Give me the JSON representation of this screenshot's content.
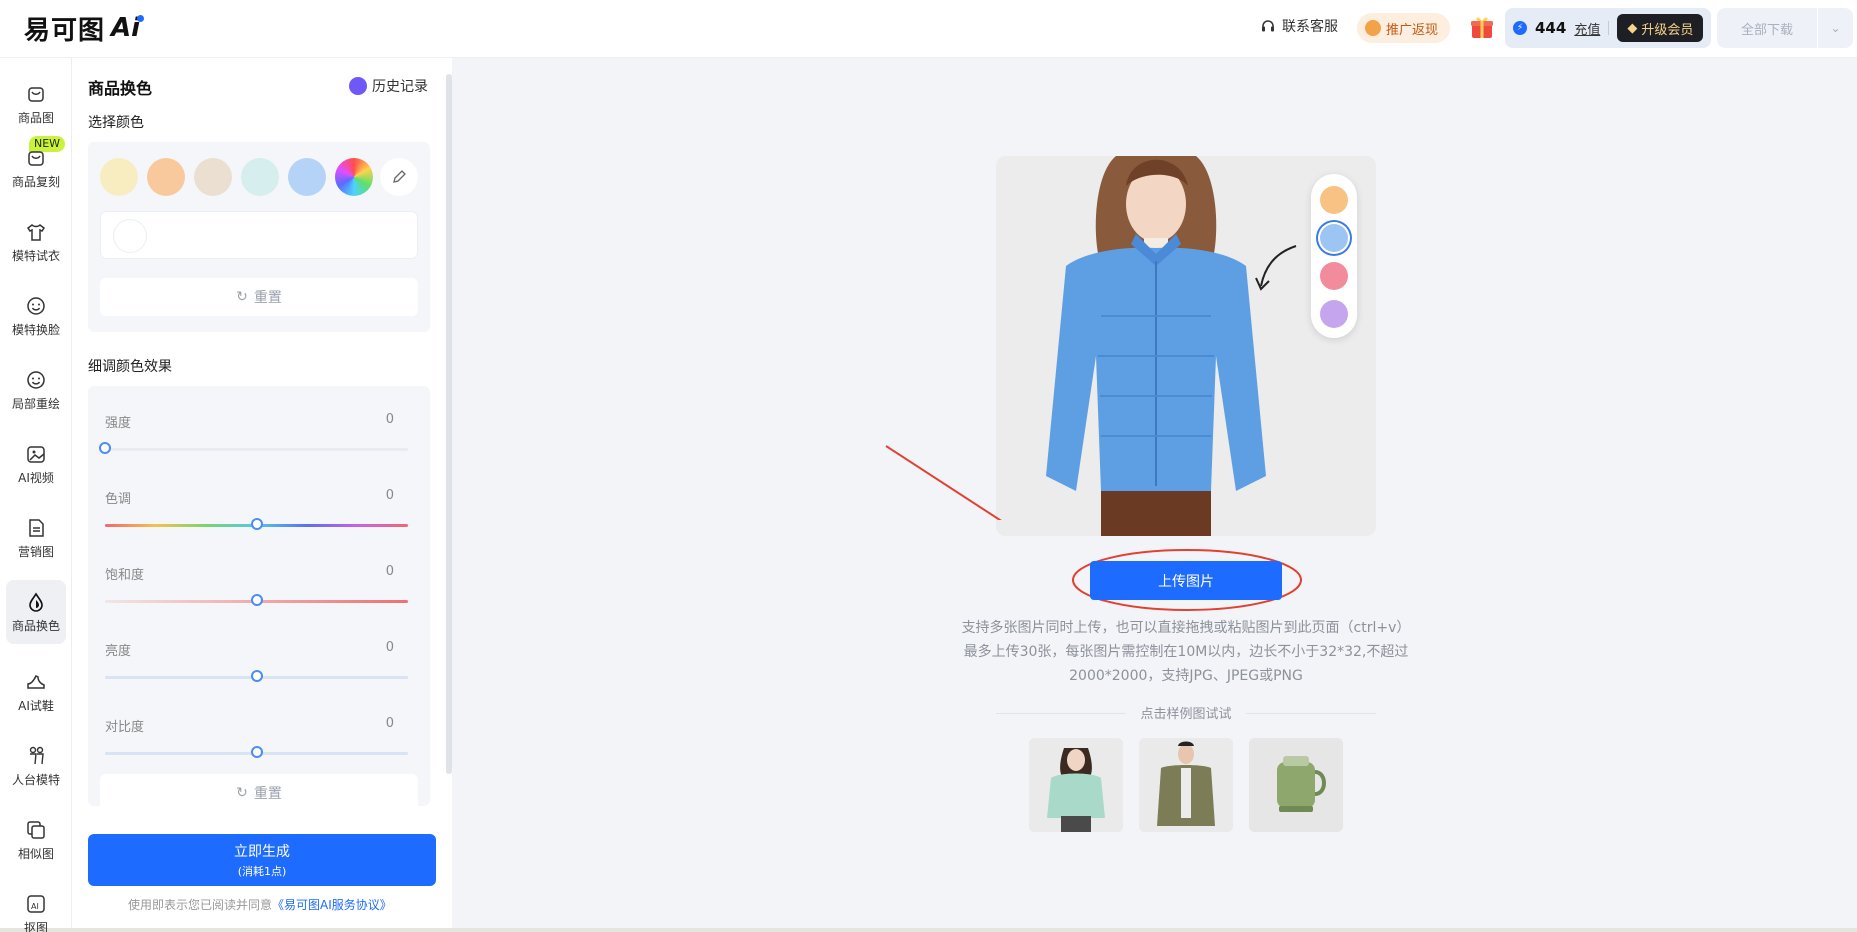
{
  "header": {
    "logo_text": "易可图",
    "logo_ai": "Ai",
    "service_label": "联系客服",
    "promo_label": "推广返现",
    "points_value": "444",
    "recharge_label": "充值",
    "vip_label": "升级会员",
    "download_label": "全部下载"
  },
  "nav": {
    "items": [
      {
        "label": "商品图",
        "icon": "product-image-icon"
      },
      {
        "label": "商品复刻",
        "icon": "product-replicate-icon"
      },
      {
        "label": "模特试衣",
        "icon": "tshirt-icon"
      },
      {
        "label": "模特换脸",
        "icon": "face-swap-icon"
      },
      {
        "label": "局部重绘",
        "icon": "face-redraw-icon"
      },
      {
        "label": "AI视频",
        "icon": "video-icon"
      },
      {
        "label": "营销图",
        "icon": "marketing-icon"
      },
      {
        "label": "商品换色",
        "icon": "color-drop-icon"
      },
      {
        "label": "AI试鞋",
        "icon": "shoe-icon"
      },
      {
        "label": "人台模特",
        "icon": "mannequin-icon"
      },
      {
        "label": "相似图",
        "icon": "similar-image-icon"
      },
      {
        "label": "抠图",
        "icon": "cutout-icon"
      }
    ],
    "badge_new": "NEW",
    "active_index": 7
  },
  "panel": {
    "title": "商品换色",
    "history_label": "历史记录",
    "select_color_label": "选择颜色",
    "swatches": [
      "#f8edc0",
      "#f8c99c",
      "#eadfd0",
      "#d6eeee",
      "#b5d3f7",
      "rainbow"
    ],
    "reset_label": "重置",
    "fine_tune_label": "细调颜色效果",
    "sliders": [
      {
        "label": "强度",
        "value": "0",
        "level": 0
      },
      {
        "label": "色调",
        "value": "0",
        "level": 0.5
      },
      {
        "label": "饱和度",
        "value": "0",
        "level": 0.5
      },
      {
        "label": "亮度",
        "value": "0",
        "level": 0.5
      },
      {
        "label": "对比度",
        "value": "0",
        "level": 0.5
      }
    ],
    "reset2_label": "重置",
    "generate_label": "立即生成",
    "generate_cost": "(消耗1点)",
    "agree_prefix": "使用即表示您已阅读并同意",
    "agree_link": "《易可图AI服务协议》"
  },
  "main": {
    "palette_colors": [
      "#f7c283",
      "#9cc5f4",
      "#f28c9d",
      "#c6a5ef"
    ],
    "upload_label": "上传图片",
    "hint_lines": [
      "支持多张图片同时上传，也可以直接拖拽或粘贴图片到此页面（ctrl+v）",
      "最多上传30张，每张图片需控制在10M以内，边长不小于32*32,不超过",
      "2000*2000，支持JPG、JPEG或PNG"
    ],
    "try_label": "点击样例图试试",
    "accent": "#1e6bff"
  }
}
